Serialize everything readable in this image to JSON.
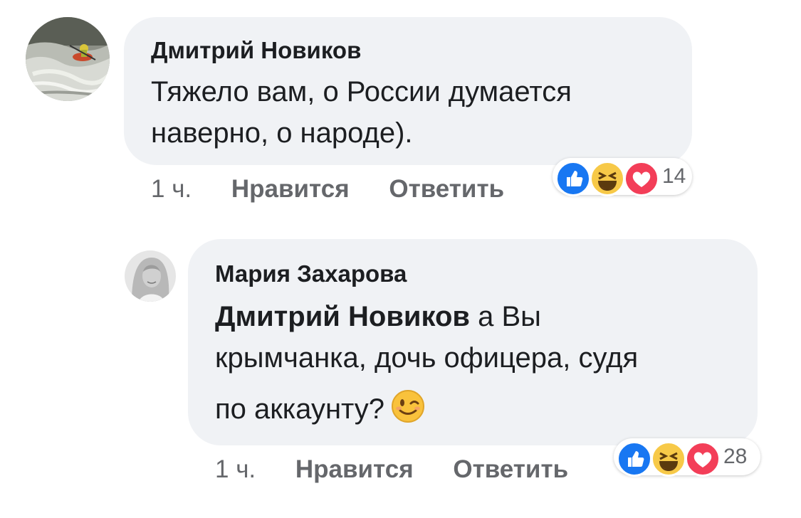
{
  "comments": [
    {
      "author": "Дмитрий Новиков",
      "avatar_icon": "kayaker-photo-avatar",
      "text_lines": [
        "Тяжело вам, о России думается",
        "наверно, о народе)."
      ],
      "time": "1 ч.",
      "like_label": "Нравится",
      "reply_label": "Ответить",
      "reaction_icons": [
        "like-icon",
        "haha-icon",
        "love-icon"
      ],
      "reaction_count": "14"
    },
    {
      "author": "Мария Захарова",
      "avatar_icon": "woman-portrait-avatar",
      "mention": "Дмитрий Новиков",
      "text_lines": [
        " а Вы",
        "крымчанка, дочь офицера, судя",
        "по аккаунту?"
      ],
      "emoji": "wink-emoji-icon",
      "time": "1 ч.",
      "like_label": "Нравится",
      "reply_label": "Ответить",
      "reaction_icons": [
        "like-icon",
        "haha-icon",
        "love-icon"
      ],
      "reaction_count": "28"
    }
  ],
  "colors": {
    "bubble": "#f0f2f5",
    "meta_text": "#65676b",
    "like_blue": "#1877f2",
    "love_red": "#f33e58",
    "haha_yellow": "#f7c948"
  }
}
